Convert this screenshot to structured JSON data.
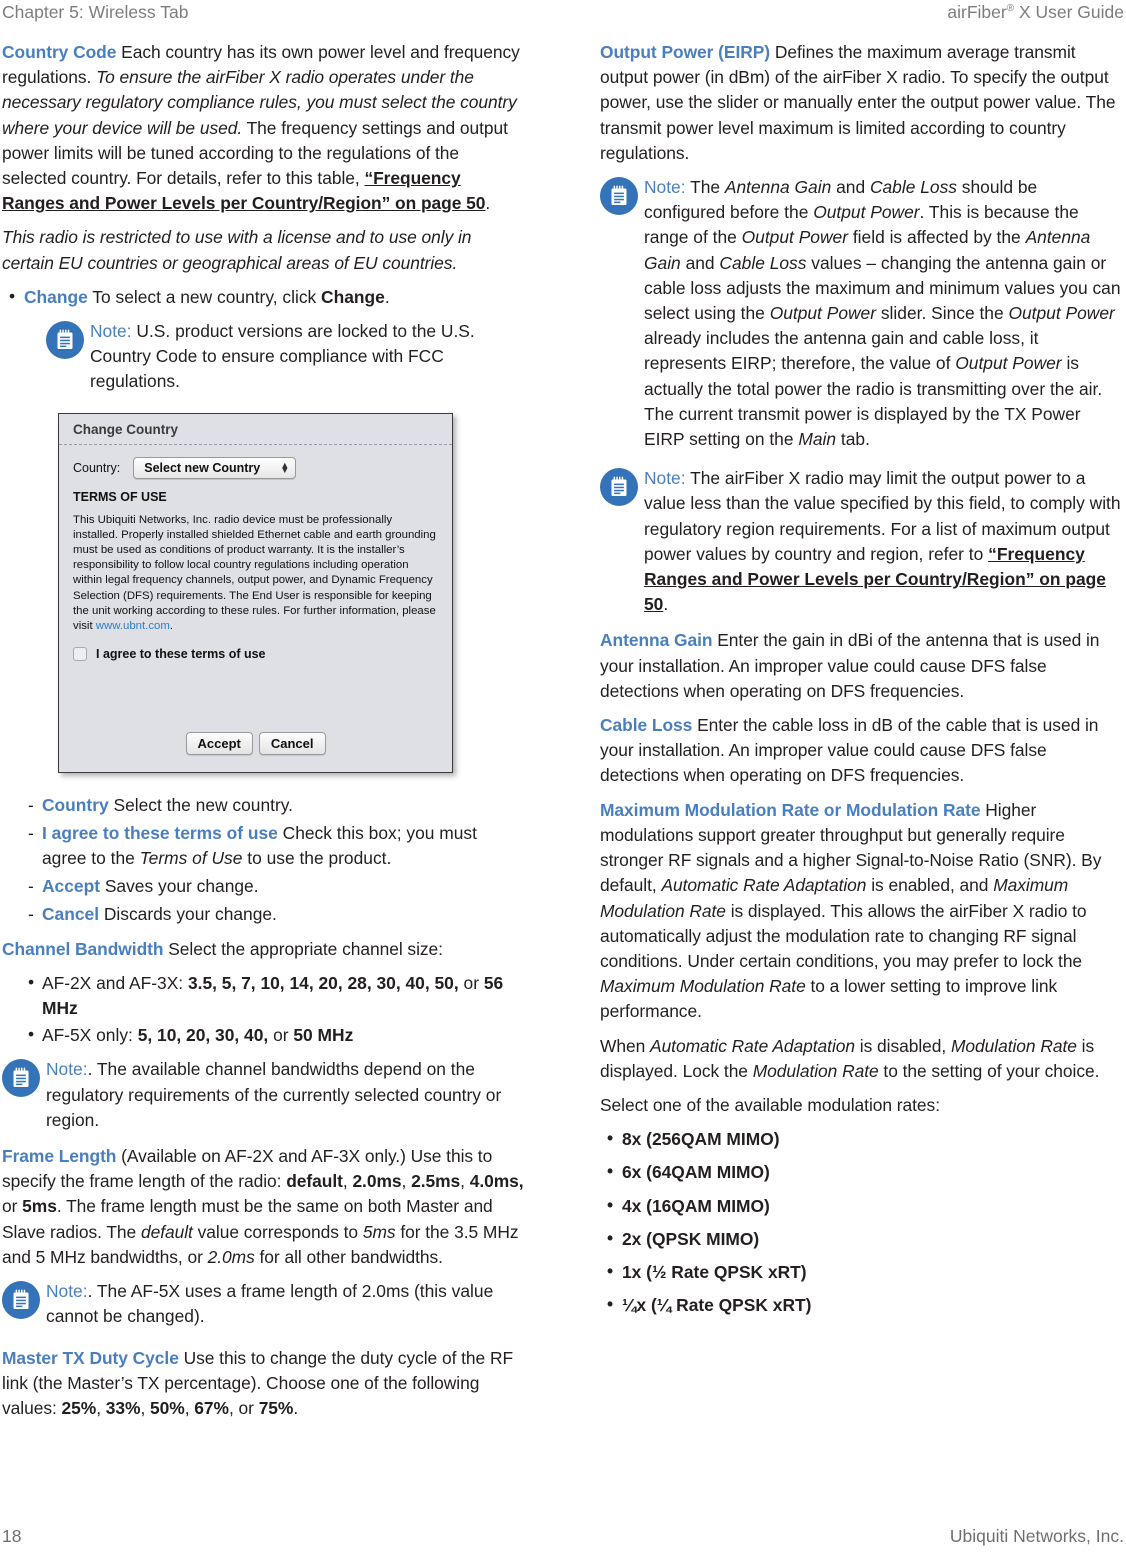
{
  "header": {
    "chapter": "Chapter 5: Wireless Tab",
    "guide_prefix": "airFiber",
    "guide_reg": "®",
    "guide_suffix": " X User Guide"
  },
  "colors": {
    "heading_blue": "#4a7fbf",
    "note_icon_blue": "#3573b9",
    "running_head_gray": "#7d7d7d",
    "body_black": "#231f20",
    "link_blue": "#2f7ccd"
  },
  "left_column": {
    "country_code": {
      "lead": "Country Code",
      "p1_a": "  Each country has its own power level and frequency regulations. ",
      "p1_italic": "To ensure the airFiber X radio operates under the necessary regulatory compliance rules, you must select the country where your device will be used.",
      "p1_b": " The frequency settings and output power limits will be tuned according to the regulations of the selected country. For details, refer to this table, ",
      "p1_xref": "“Frequency Ranges and Power Levels per Country/Region” on page 50",
      "p1_c": ".",
      "p2_italic": "This radio is restricted to use with a license and to use only in certain EU countries or geographical areas of EU countries."
    },
    "change_bullet": {
      "lead": "Change",
      "text_a": "  To select a new country, click ",
      "bold": "Change",
      "text_b": "."
    },
    "note_us": {
      "label": "Note:",
      "text": " U.S. product versions are locked to the U.S. Country Code to ensure compliance with FCC regulations."
    },
    "screenshot": {
      "title": "Change Country",
      "country_label": "Country:",
      "country_value": "Select new Country",
      "terms_heading": "TERMS OF USE",
      "terms_body_a": "This Ubiquiti Networks, Inc. radio device must be professionally installed. Properly installed shielded Ethernet cable and earth grounding must be used as conditions of product warranty. It is the installer’s responsibility to follow local country regulations including operation within legal frequency channels, output power, and Dynamic Frequency Selection (DFS) requirements. The End User is responsible for keeping the unit working according to these rules. For further information, please visit ",
      "terms_link": "www.ubnt.com",
      "terms_body_b": ".",
      "agree_label": "I agree to these terms of use",
      "accept_button": "Accept",
      "cancel_button": "Cancel"
    },
    "dash_items": [
      {
        "lead": "Country",
        "text_a": "  Select the new country.",
        "italic": "",
        "text_b": ""
      },
      {
        "lead": "I agree to these terms of use",
        "text_a": "  Check this box; you must agree to the ",
        "italic": "Terms of Use",
        "text_b": " to use the product."
      },
      {
        "lead": "Accept",
        "text_a": "  Saves your change.",
        "italic": "",
        "text_b": ""
      },
      {
        "lead": "Cancel",
        "text_a": "  Discards your change.",
        "italic": "",
        "text_b": ""
      }
    ],
    "channel_bandwidth": {
      "lead": "Channel Bandwidth",
      "text": "  Select the appropriate channel size:",
      "bullets": [
        {
          "plain_a": "AF-2X and AF-3X:  ",
          "bold_list": "3.5, 5, 7, 10, 14, 20, 28, 30, 40, 50,",
          "mid": " or ",
          "bold_end": "56 MHz"
        },
        {
          "plain_a": "AF-5X only:  ",
          "bold_list": "5, 10, 20, 30, 40,",
          "mid": " or ",
          "bold_end": "50 MHz"
        }
      ]
    },
    "note_bandwidth": {
      "label": "Note:",
      "text": ". The available channel bandwidths depend on the regulatory requirements of the currently selected country or region."
    },
    "frame_length": {
      "lead": "Frame Length",
      "text_a": "  (Available on AF-2X and AF-3X only.) Use this to specify the frame length of the radio: ",
      "bold_1": "default",
      "text_b": ", ",
      "bold_2": "2.0ms",
      "text_c": ", ",
      "bold_3": "2.5ms",
      "text_d": ", ",
      "bold_4": "4.0ms,",
      "text_e": " or ",
      "bold_5": "5ms",
      "text_f": ". The frame length must be the same on both Master and Slave radios. The ",
      "italic_1": "default",
      "text_g": " value corresponds to ",
      "italic_2": "5ms",
      "text_h": " for the 3.5 MHz and 5 MHz bandwidths, or ",
      "italic_3": "2.0ms",
      "text_i": " for all other bandwidths."
    },
    "note_af5x": {
      "label": "Note:",
      "text": ". The AF-5X uses a frame length of 2.0ms (this value cannot be changed)."
    },
    "master_tx": {
      "lead": "Master TX Duty Cycle",
      "text_a": "  Use this to change the duty cycle of the RF link (the Master’s TX percentage). Choose one of the following values: ",
      "bold_1": "25%",
      "t1": ", ",
      "bold_2": "33%",
      "t2": ", ",
      "bold_3": "50%",
      "t3": ", ",
      "bold_4": "67%",
      "t4": ", or ",
      "bold_5": "75%",
      "t5": "."
    }
  },
  "right_column": {
    "output_power": {
      "lead": "Output Power (EIRP)",
      "text": "  Defines the maximum average transmit output power (in dBm) of the airFiber X radio. To specify the output power, use the slider or manually enter the output power value. The transmit power level maximum is limited according to country regulations."
    },
    "note_gain": {
      "label": "Note:",
      "t1": " The ",
      "i1": "Antenna Gain",
      "t2": " and ",
      "i2": "Cable Loss",
      "t3": " should be configured before the ",
      "i3": "Output Power",
      "t4": ". This is because the range of the ",
      "i4": "Output Power",
      "t5": " field is affected by the ",
      "i5": "Antenna Gain",
      "t6": " and ",
      "i6": "Cable Loss",
      "t7": " values – changing the antenna gain or cable loss adjusts the maximum and minimum values you can select using the ",
      "i7": "Output Power",
      "t8": " slider. Since the ",
      "i8": "Output Power",
      "t9": " already includes the antenna gain and cable loss, it represents EIRP; therefore, the value of ",
      "i9": "Output Power",
      "t10": " is actually the total power the radio is transmitting over the air. The current transmit power is displayed by the TX Power EIRP setting on the ",
      "i10": "Main",
      "t11": " tab."
    },
    "note_limit": {
      "label": "Note:",
      "t1": " The airFiber X radio may limit the output power to a value less than the value specified by this field, to comply with regulatory region requirements. For a list of maximum output power values by country and region, refer to ",
      "xref": "“Frequency Ranges and Power Levels per Country/Region” on page 50",
      "t2": "."
    },
    "antenna_gain": {
      "lead": "Antenna Gain",
      "text": "  Enter the gain in dBi of the antenna that is used in your installation. An improper value could cause DFS false detections when operating on DFS frequencies."
    },
    "cable_loss": {
      "lead": "Cable Loss",
      "text": "  Enter the cable loss in dB of the cable that is used in your installation. An improper value could cause DFS false detections when operating on DFS frequencies."
    },
    "mod_rate": {
      "lead": "Maximum Modulation Rate or Modulation Rate",
      "t1": "  Higher modulations support greater throughput but generally require stronger RF signals and a higher Signal-to-Noise Ratio (SNR). By default, ",
      "i1": "Automatic Rate Adaptation",
      "t2": " is enabled, and ",
      "i2": "Maximum Modulation Rate",
      "t3": " is displayed. This allows the airFiber X radio to automatically adjust the modulation rate to changing RF signal conditions. Under certain conditions, you may prefer to lock the ",
      "i3": "Maximum Modulation Rate",
      "t4": " to a lower setting to improve link performance."
    },
    "mod_rate_p2": {
      "t1": "When ",
      "i1": "Automatic Rate Adaptation",
      "t2": " is disabled, ",
      "i2": "Modulation Rate",
      "t3": " is displayed. Lock the ",
      "i3": "Modulation Rate",
      "t4": " to the setting of your choice."
    },
    "select_intro": "Select one of the available modulation rates:",
    "rates": [
      "8x (256QAM MIMO)",
      "6x (64QAM MIMO)",
      "4x (16QAM MIMO)",
      "2x (QPSK MIMO)",
      "1x (½ Rate QPSK xRT)",
      "¼x (¼ Rate QPSK xRT)"
    ]
  },
  "footer": {
    "page_number": "18",
    "publisher": "Ubiquiti Networks, Inc."
  }
}
